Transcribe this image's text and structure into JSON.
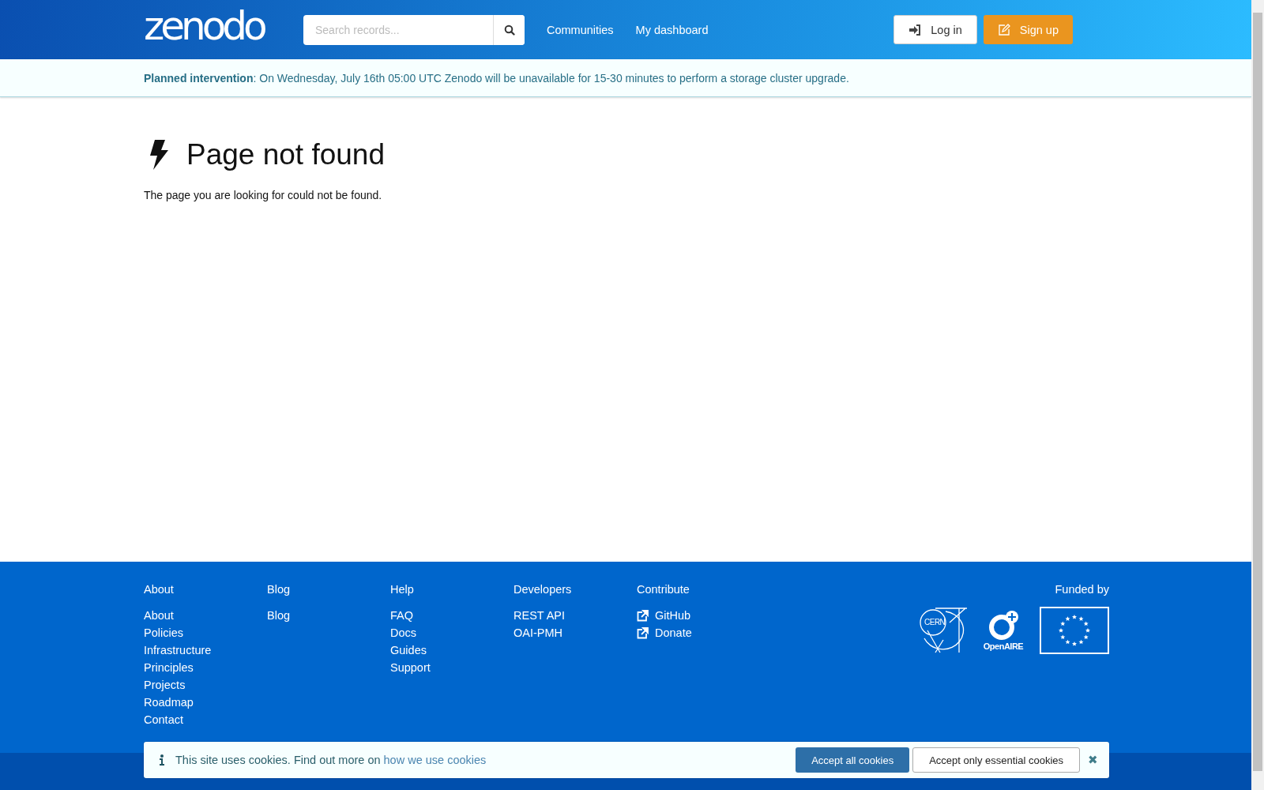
{
  "header": {
    "logo": "zenodo",
    "search": {
      "placeholder": "Search records..."
    },
    "nav": [
      "Communities",
      "My dashboard"
    ],
    "buttons": [
      {
        "kind": "login",
        "label": "Log in"
      },
      {
        "kind": "signup",
        "label": "Sign up"
      }
    ]
  },
  "announcement": {
    "title": "Planned intervention",
    "text": ": On Wednesday, July 16th 05:00 UTC Zenodo will be unavailable for 15-30 minutes to perform a storage cluster upgrade."
  },
  "error": {
    "title": "Page not found",
    "message": "The page you are looking for could not be found."
  },
  "footer": {
    "columns": [
      {
        "heading": "About",
        "links": [
          {
            "label": "About",
            "external": false
          },
          {
            "label": "Policies",
            "external": false
          },
          {
            "label": "Infrastructure",
            "external": false
          },
          {
            "label": "Principles",
            "external": false
          },
          {
            "label": "Projects",
            "external": false
          },
          {
            "label": "Roadmap",
            "external": false
          },
          {
            "label": "Contact",
            "external": false
          }
        ]
      },
      {
        "heading": "Blog",
        "links": [
          {
            "label": "Blog",
            "external": false
          }
        ]
      },
      {
        "heading": "Help",
        "links": [
          {
            "label": "FAQ",
            "external": false
          },
          {
            "label": "Docs",
            "external": false
          },
          {
            "label": "Guides",
            "external": false
          },
          {
            "label": "Support",
            "external": false
          }
        ]
      },
      {
        "heading": "Developers",
        "links": [
          {
            "label": "REST API",
            "external": false
          },
          {
            "label": "OAI-PMH",
            "external": false
          }
        ]
      },
      {
        "heading": "Contribute",
        "links": [
          {
            "label": "GitHub",
            "external": true
          },
          {
            "label": "Donate",
            "external": true
          }
        ]
      }
    ],
    "funded_by": "Funded by",
    "funders": [
      {
        "kind": "cern",
        "label": "CERN"
      },
      {
        "kind": "openaire",
        "label": "OpenAIRE"
      },
      {
        "kind": "eu"
      }
    ]
  },
  "cookie_banner": {
    "text": "This site uses cookies. Find out more on ",
    "link": "how we use cookies",
    "buttons": [
      {
        "kind": "primary",
        "label": "Accept all cookies"
      },
      {
        "kind": "secondary",
        "label": "Accept only essential cookies"
      }
    ],
    "close": "✖"
  }
}
